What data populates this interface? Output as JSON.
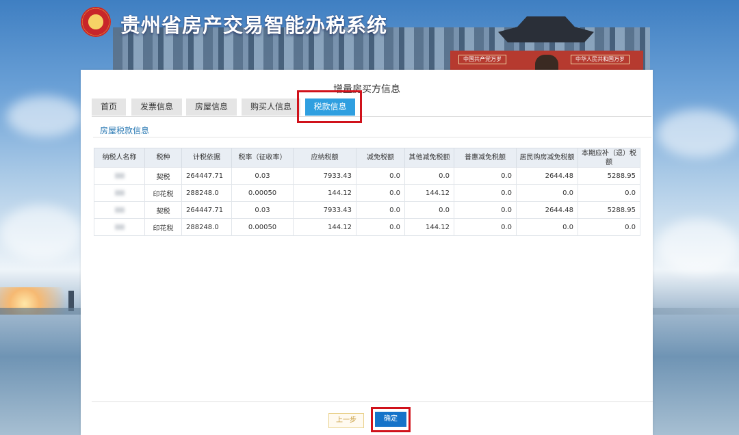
{
  "app": {
    "title": "贵州省房产交易智能办税系统",
    "header_plaques": [
      "中国共产党万岁",
      "中华人民共和国万岁"
    ]
  },
  "page": {
    "title": "增量房买方信息"
  },
  "tabs": [
    {
      "label": "首页",
      "active": false
    },
    {
      "label": "发票信息",
      "active": false
    },
    {
      "label": "房屋信息",
      "active": false
    },
    {
      "label": "购买人信息",
      "active": false
    },
    {
      "label": "税款信息",
      "active": true
    }
  ],
  "section": {
    "title": "房屋税款信息"
  },
  "table": {
    "headers": [
      "纳税人名称",
      "税种",
      "计税依据",
      "税率（征收率）",
      "应纳税额",
      "减免税额",
      "其他减免税额",
      "普惠减免税额",
      "居民购房减免税额",
      "本期应补（退）税额"
    ],
    "rows": [
      {
        "name": "",
        "tax_type": "契税",
        "basis": "264447.71",
        "rate": "0.03",
        "payable": "7933.43",
        "reduction": "0.0",
        "other_reduction": "0.0",
        "inclusive_reduction": "0.0",
        "resident_reduction": "2644.48",
        "due": "5288.95"
      },
      {
        "name": "",
        "tax_type": "印花税",
        "basis": "288248.0",
        "rate": "0.00050",
        "payable": "144.12",
        "reduction": "0.0",
        "other_reduction": "144.12",
        "inclusive_reduction": "0.0",
        "resident_reduction": "0.0",
        "due": "0.0"
      },
      {
        "name": "",
        "tax_type": "契税",
        "basis": "264447.71",
        "rate": "0.03",
        "payable": "7933.43",
        "reduction": "0.0",
        "other_reduction": "0.0",
        "inclusive_reduction": "0.0",
        "resident_reduction": "2644.48",
        "due": "5288.95"
      },
      {
        "name": "",
        "tax_type": "印花税",
        "basis": "288248.0",
        "rate": "0.00050",
        "payable": "144.12",
        "reduction": "0.0",
        "other_reduction": "144.12",
        "inclusive_reduction": "0.0",
        "resident_reduction": "0.0",
        "due": "0.0"
      }
    ]
  },
  "buttons": {
    "prev": "上一步",
    "confirm": "确定"
  },
  "colors": {
    "accent": "#2f9fe0",
    "primary_button": "#1573c9",
    "highlight_box": "#d0121b"
  }
}
